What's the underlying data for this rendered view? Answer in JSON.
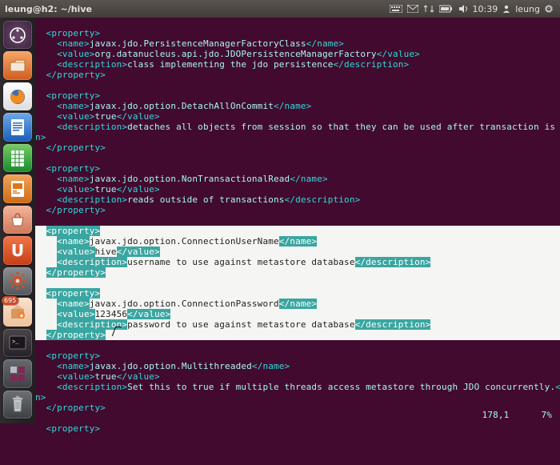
{
  "panel": {
    "title": "leung@h2: ~/hive",
    "time": "10:39",
    "user": "leung"
  },
  "launcher": {
    "update_badge": "695"
  },
  "xml": {
    "props": [
      {
        "name": "javax.jdo.PersistenceManagerFactoryClass",
        "value": "org.datanucleus.api.jdo.JDOPersistenceManagerFactory",
        "desc": "class implementing the jdo persistence",
        "desc_close_wrap": false
      },
      {
        "name": "javax.jdo.option.DetachAllOnCommit",
        "value": "true",
        "desc": "detaches all objects from session so that they can be used after transaction is committed",
        "desc_close_wrap": true
      },
      {
        "name": "javax.jdo.option.NonTransactionalRead",
        "value": "true",
        "desc": "reads outside of transactions",
        "desc_close_wrap": false
      },
      {
        "name": "javax.jdo.option.ConnectionUserName",
        "value": "hive",
        "desc": "username to use against metastore database",
        "desc_close_wrap": false
      },
      {
        "name": "javax.jdo.option.ConnectionPassword",
        "value": "123456",
        "desc": "password to use against metastore database",
        "desc_close_wrap": false
      },
      {
        "name": "javax.jdo.option.Multithreaded",
        "value": "true",
        "desc": "Set this to true if multiple threads access metastore through JDO concurrently.",
        "desc_close_wrap": true
      }
    ],
    "lonely_open": "<property>"
  },
  "status": {
    "pos": "178,1",
    "pct": "7%"
  }
}
